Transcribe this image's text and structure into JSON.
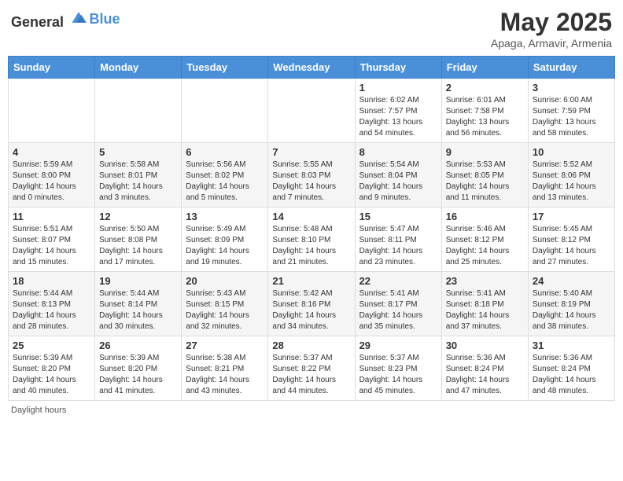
{
  "header": {
    "logo_general": "General",
    "logo_blue": "Blue",
    "month_title": "May 2025",
    "subtitle": "Apaga, Armavir, Armenia"
  },
  "days_of_week": [
    "Sunday",
    "Monday",
    "Tuesday",
    "Wednesday",
    "Thursday",
    "Friday",
    "Saturday"
  ],
  "footer": {
    "daylight_label": "Daylight hours"
  },
  "weeks": [
    {
      "days": [
        {
          "number": "",
          "info": ""
        },
        {
          "number": "",
          "info": ""
        },
        {
          "number": "",
          "info": ""
        },
        {
          "number": "",
          "info": ""
        },
        {
          "number": "1",
          "info": "Sunrise: 6:02 AM\nSunset: 7:57 PM\nDaylight: 13 hours and 54 minutes."
        },
        {
          "number": "2",
          "info": "Sunrise: 6:01 AM\nSunset: 7:58 PM\nDaylight: 13 hours and 56 minutes."
        },
        {
          "number": "3",
          "info": "Sunrise: 6:00 AM\nSunset: 7:59 PM\nDaylight: 13 hours and 58 minutes."
        }
      ]
    },
    {
      "days": [
        {
          "number": "4",
          "info": "Sunrise: 5:59 AM\nSunset: 8:00 PM\nDaylight: 14 hours and 0 minutes."
        },
        {
          "number": "5",
          "info": "Sunrise: 5:58 AM\nSunset: 8:01 PM\nDaylight: 14 hours and 3 minutes."
        },
        {
          "number": "6",
          "info": "Sunrise: 5:56 AM\nSunset: 8:02 PM\nDaylight: 14 hours and 5 minutes."
        },
        {
          "number": "7",
          "info": "Sunrise: 5:55 AM\nSunset: 8:03 PM\nDaylight: 14 hours and 7 minutes."
        },
        {
          "number": "8",
          "info": "Sunrise: 5:54 AM\nSunset: 8:04 PM\nDaylight: 14 hours and 9 minutes."
        },
        {
          "number": "9",
          "info": "Sunrise: 5:53 AM\nSunset: 8:05 PM\nDaylight: 14 hours and 11 minutes."
        },
        {
          "number": "10",
          "info": "Sunrise: 5:52 AM\nSunset: 8:06 PM\nDaylight: 14 hours and 13 minutes."
        }
      ]
    },
    {
      "days": [
        {
          "number": "11",
          "info": "Sunrise: 5:51 AM\nSunset: 8:07 PM\nDaylight: 14 hours and 15 minutes."
        },
        {
          "number": "12",
          "info": "Sunrise: 5:50 AM\nSunset: 8:08 PM\nDaylight: 14 hours and 17 minutes."
        },
        {
          "number": "13",
          "info": "Sunrise: 5:49 AM\nSunset: 8:09 PM\nDaylight: 14 hours and 19 minutes."
        },
        {
          "number": "14",
          "info": "Sunrise: 5:48 AM\nSunset: 8:10 PM\nDaylight: 14 hours and 21 minutes."
        },
        {
          "number": "15",
          "info": "Sunrise: 5:47 AM\nSunset: 8:11 PM\nDaylight: 14 hours and 23 minutes."
        },
        {
          "number": "16",
          "info": "Sunrise: 5:46 AM\nSunset: 8:12 PM\nDaylight: 14 hours and 25 minutes."
        },
        {
          "number": "17",
          "info": "Sunrise: 5:45 AM\nSunset: 8:12 PM\nDaylight: 14 hours and 27 minutes."
        }
      ]
    },
    {
      "days": [
        {
          "number": "18",
          "info": "Sunrise: 5:44 AM\nSunset: 8:13 PM\nDaylight: 14 hours and 28 minutes."
        },
        {
          "number": "19",
          "info": "Sunrise: 5:44 AM\nSunset: 8:14 PM\nDaylight: 14 hours and 30 minutes."
        },
        {
          "number": "20",
          "info": "Sunrise: 5:43 AM\nSunset: 8:15 PM\nDaylight: 14 hours and 32 minutes."
        },
        {
          "number": "21",
          "info": "Sunrise: 5:42 AM\nSunset: 8:16 PM\nDaylight: 14 hours and 34 minutes."
        },
        {
          "number": "22",
          "info": "Sunrise: 5:41 AM\nSunset: 8:17 PM\nDaylight: 14 hours and 35 minutes."
        },
        {
          "number": "23",
          "info": "Sunrise: 5:41 AM\nSunset: 8:18 PM\nDaylight: 14 hours and 37 minutes."
        },
        {
          "number": "24",
          "info": "Sunrise: 5:40 AM\nSunset: 8:19 PM\nDaylight: 14 hours and 38 minutes."
        }
      ]
    },
    {
      "days": [
        {
          "number": "25",
          "info": "Sunrise: 5:39 AM\nSunset: 8:20 PM\nDaylight: 14 hours and 40 minutes."
        },
        {
          "number": "26",
          "info": "Sunrise: 5:39 AM\nSunset: 8:20 PM\nDaylight: 14 hours and 41 minutes."
        },
        {
          "number": "27",
          "info": "Sunrise: 5:38 AM\nSunset: 8:21 PM\nDaylight: 14 hours and 43 minutes."
        },
        {
          "number": "28",
          "info": "Sunrise: 5:37 AM\nSunset: 8:22 PM\nDaylight: 14 hours and 44 minutes."
        },
        {
          "number": "29",
          "info": "Sunrise: 5:37 AM\nSunset: 8:23 PM\nDaylight: 14 hours and 45 minutes."
        },
        {
          "number": "30",
          "info": "Sunrise: 5:36 AM\nSunset: 8:24 PM\nDaylight: 14 hours and 47 minutes."
        },
        {
          "number": "31",
          "info": "Sunrise: 5:36 AM\nSunset: 8:24 PM\nDaylight: 14 hours and 48 minutes."
        }
      ]
    }
  ]
}
